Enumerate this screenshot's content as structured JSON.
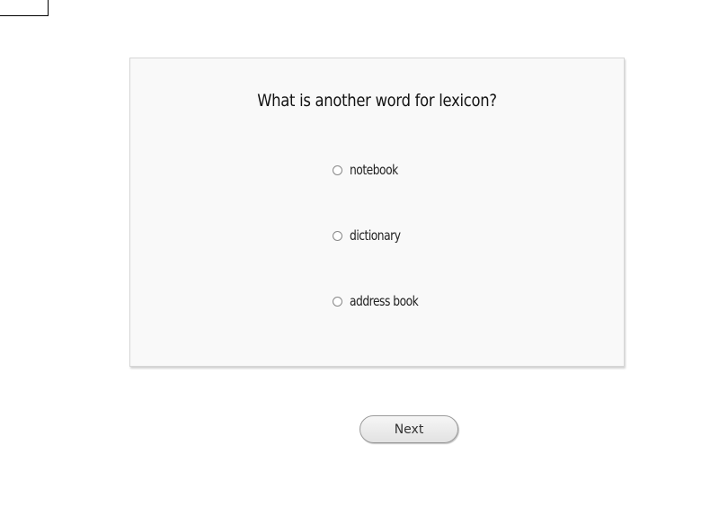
{
  "quiz": {
    "question": "What is another word for lexicon?",
    "options": [
      {
        "label": "notebook",
        "selected": false
      },
      {
        "label": "dictionary",
        "selected": false
      },
      {
        "label": "address book",
        "selected": false
      }
    ]
  },
  "navigation": {
    "next_label": "Next"
  }
}
